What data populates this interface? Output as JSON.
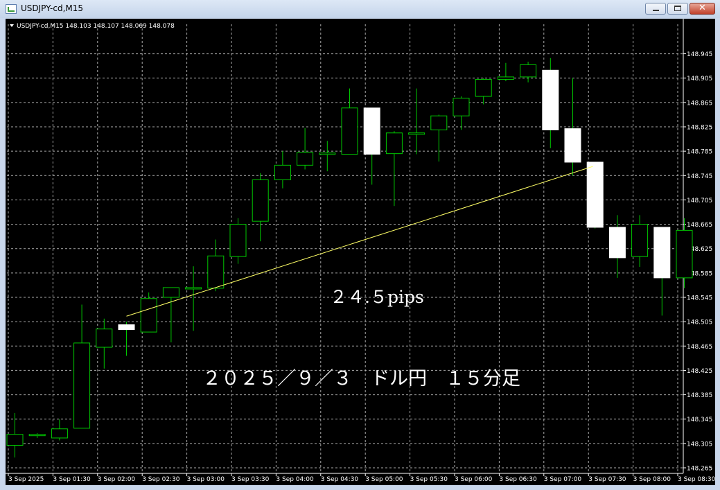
{
  "window": {
    "title": "USDJPY-cd,M15",
    "minimize_glyph": "",
    "maximize_glyph": "",
    "close_glyph": "✕"
  },
  "chart_header": {
    "text": "USDJPY-cd,M15  148.103 148.107 148.069 148.078",
    "dropdown_icon": "triangle-down-icon"
  },
  "colors": {
    "background": "#000000",
    "grid": "#c8c8c8",
    "candle_outline": "#00c800",
    "bull_fill": "#000000",
    "bear_fill": "#ffffff",
    "trendline": "#ffff66",
    "text": "#ffffff",
    "window_frame": "#c9d7ec"
  },
  "annotations": {
    "pips_text": "２４.５pips",
    "caption": "２０２５／９／３　ドル円　１５分足"
  },
  "chart_data": {
    "type": "candlestick",
    "symbol": "USDJPY-cd",
    "timeframe": "M15",
    "ylim": [
      148.265,
      148.965
    ],
    "y_ticks": [
      148.945,
      148.905,
      148.865,
      148.825,
      148.785,
      148.745,
      148.705,
      148.665,
      148.625,
      148.585,
      148.545,
      148.505,
      148.465,
      148.425,
      148.385,
      148.345,
      148.305,
      148.265
    ],
    "x_ticks": [
      {
        "index": 0,
        "label": "3 Sep 2025"
      },
      {
        "index": 2,
        "label": "3 Sep 01:30"
      },
      {
        "index": 4,
        "label": "3 Sep 02:00"
      },
      {
        "index": 6,
        "label": "3 Sep 02:30"
      },
      {
        "index": 8,
        "label": "3 Sep 03:00"
      },
      {
        "index": 10,
        "label": "3 Sep 03:30"
      },
      {
        "index": 12,
        "label": "3 Sep 04:00"
      },
      {
        "index": 14,
        "label": "3 Sep 04:30"
      },
      {
        "index": 16,
        "label": "3 Sep 05:00"
      },
      {
        "index": 18,
        "label": "3 Sep 05:30"
      },
      {
        "index": 20,
        "label": "3 Sep 06:00"
      },
      {
        "index": 22,
        "label": "3 Sep 06:30"
      },
      {
        "index": 24,
        "label": "3 Sep 07:00"
      },
      {
        "index": 26,
        "label": "3 Sep 07:30"
      },
      {
        "index": 28,
        "label": "3 Sep 08:00"
      },
      {
        "index": 30,
        "label": "3 Sep 08:30"
      }
    ],
    "candles": [
      {
        "o": 148.302,
        "h": 148.355,
        "l": 148.282,
        "c": 148.32
      },
      {
        "o": 148.318,
        "h": 148.322,
        "l": 148.314,
        "c": 148.32
      },
      {
        "o": 148.314,
        "h": 148.345,
        "l": 148.31,
        "c": 148.329
      },
      {
        "o": 148.33,
        "h": 148.533,
        "l": 148.33,
        "c": 148.47
      },
      {
        "o": 148.463,
        "h": 148.51,
        "l": 148.428,
        "c": 148.493
      },
      {
        "o": 148.5,
        "h": 148.505,
        "l": 148.449,
        "c": 148.492
      },
      {
        "o": 148.488,
        "h": 148.553,
        "l": 148.488,
        "c": 148.543
      },
      {
        "o": 148.545,
        "h": 148.56,
        "l": 148.471,
        "c": 148.561
      },
      {
        "o": 148.56,
        "h": 148.596,
        "l": 148.49,
        "c": 148.561
      },
      {
        "o": 148.56,
        "h": 148.64,
        "l": 148.555,
        "c": 148.613
      },
      {
        "o": 148.612,
        "h": 148.675,
        "l": 148.6,
        "c": 148.665
      },
      {
        "o": 148.67,
        "h": 148.749,
        "l": 148.637,
        "c": 148.738
      },
      {
        "o": 148.738,
        "h": 148.785,
        "l": 148.724,
        "c": 148.762
      },
      {
        "o": 148.762,
        "h": 148.823,
        "l": 148.755,
        "c": 148.783
      },
      {
        "o": 148.781,
        "h": 148.802,
        "l": 148.752,
        "c": 148.782
      },
      {
        "o": 148.78,
        "h": 148.888,
        "l": 148.78,
        "c": 148.856
      },
      {
        "o": 148.856,
        "h": 148.856,
        "l": 148.73,
        "c": 148.78
      },
      {
        "o": 148.781,
        "h": 148.818,
        "l": 148.695,
        "c": 148.815
      },
      {
        "o": 148.814,
        "h": 148.888,
        "l": 148.78,
        "c": 148.815
      },
      {
        "o": 148.82,
        "h": 148.845,
        "l": 148.768,
        "c": 148.843
      },
      {
        "o": 148.843,
        "h": 148.875,
        "l": 148.82,
        "c": 148.872
      },
      {
        "o": 148.875,
        "h": 148.905,
        "l": 148.862,
        "c": 148.903
      },
      {
        "o": 148.903,
        "h": 148.93,
        "l": 148.9,
        "c": 148.907
      },
      {
        "o": 148.907,
        "h": 148.932,
        "l": 148.898,
        "c": 148.927
      },
      {
        "o": 148.918,
        "h": 148.938,
        "l": 148.79,
        "c": 148.82
      },
      {
        "o": 148.822,
        "h": 148.905,
        "l": 148.745,
        "c": 148.767
      },
      {
        "o": 148.767,
        "h": 148.767,
        "l": 148.658,
        "c": 148.66
      },
      {
        "o": 148.66,
        "h": 148.68,
        "l": 148.577,
        "c": 148.61
      },
      {
        "o": 148.612,
        "h": 148.68,
        "l": 148.595,
        "c": 148.665
      },
      {
        "o": 148.66,
        "h": 148.66,
        "l": 148.515,
        "c": 148.577
      },
      {
        "o": 148.577,
        "h": 148.675,
        "l": 148.56,
        "c": 148.655
      }
    ],
    "trendline": {
      "x1": 5,
      "y1": 148.514,
      "x2": 25.9,
      "y2": 148.76
    },
    "grid": true
  }
}
